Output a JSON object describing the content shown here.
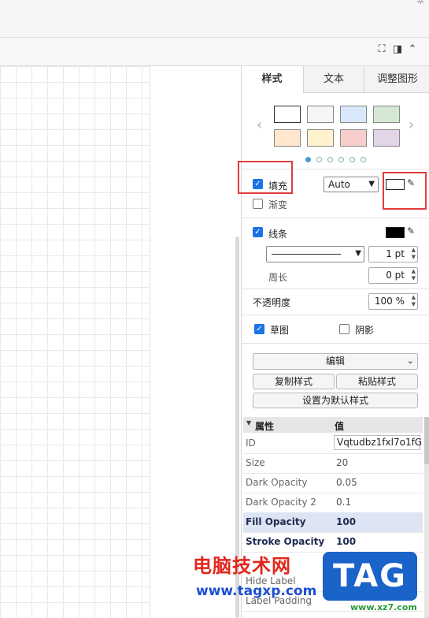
{
  "toolbar": {
    "fullscreen_icon": "fullscreen-icon",
    "panel_icon": "panel-toggle-icon",
    "collapse_icon": "chevron-up-icon"
  },
  "panel": {
    "tabs": [
      "样式",
      "文本",
      "调整图形"
    ],
    "swatch_colors": [
      "#ffffff",
      "#f5f5f5",
      "#dae8fc",
      "#d5e8d4",
      "#ffe6cc",
      "#fff2cc",
      "#f8cecc",
      "#e1d5e7"
    ],
    "fill": {
      "label": "填充",
      "checked": true,
      "mode": "Auto",
      "color": "#ffffff"
    },
    "gradient": {
      "label": "渐变",
      "checked": false
    },
    "line": {
      "label": "线条",
      "checked": true,
      "color": "#000000",
      "width": "1 pt"
    },
    "perimeter": {
      "label": "周长",
      "value": "0 pt"
    },
    "opacity": {
      "label": "不透明度",
      "value": "100 %"
    },
    "sketch": {
      "label": "草图",
      "checked": true
    },
    "shadow": {
      "label": "阴影",
      "checked": false
    },
    "edit": "编辑",
    "copy_style": "复制样式",
    "paste_style": "粘贴样式",
    "set_default": "设置为默认样式"
  },
  "properties": {
    "col_property": "属性",
    "col_value": "值",
    "rows": [
      {
        "key": "ID",
        "value": "Vqtudbz1fxl7o1fG"
      },
      {
        "key": "Size",
        "value": "20"
      },
      {
        "key": "Dark Opacity",
        "value": "0.05"
      },
      {
        "key": "Dark Opacity 2",
        "value": "0.1"
      },
      {
        "key": "Fill Opacity",
        "value": "100"
      },
      {
        "key": "Stroke Opacity",
        "value": "100"
      },
      {
        "key": "Hide Label",
        "value": ""
      },
      {
        "key": "Label Padding",
        "value": ""
      }
    ]
  },
  "watermark": {
    "title": "电脑技术网",
    "url": "www.tagxp.com",
    "badge": "TAG",
    "small": "www.xz7.com"
  }
}
